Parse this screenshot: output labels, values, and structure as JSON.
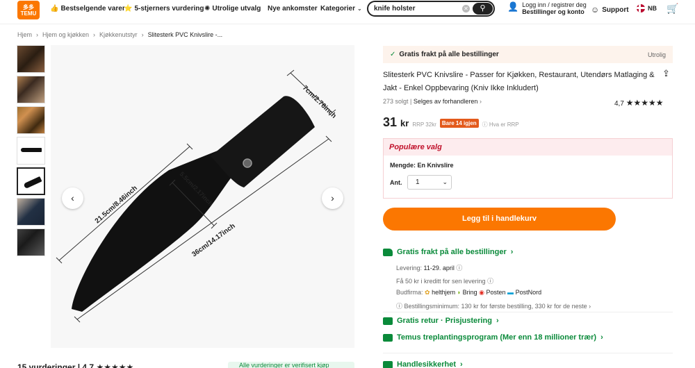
{
  "header": {
    "logo_top": "多多",
    "logo_bottom": "TEMU",
    "nav": [
      {
        "icon": "thumbs-up-icon",
        "label": "Bestselgende varer"
      },
      {
        "icon": "chat-star-icon",
        "label": "5-stjerners vurdering"
      },
      {
        "icon": "sparkle-icon",
        "label": "Utrolige utvalg"
      },
      {
        "icon": "",
        "label": "Nye ankomster"
      },
      {
        "icon": "",
        "label": "Kategorier"
      }
    ],
    "search_value": "knife holster",
    "login_line1": "Logg inn / registrer deg",
    "login_line2": "Bestillinger og konto",
    "support": "Support",
    "lang": "NB"
  },
  "breadcrumb": [
    "Hjem",
    "Hjem og kjøkken",
    "Kjøkkenutstyr",
    "Slitesterk PVC Knivslire -..."
  ],
  "image": {
    "dims": [
      "7cm/2.76inch",
      "21.5cm/8.46inch",
      "5.5cm/2.17inch",
      "36cm/14.17inch"
    ]
  },
  "product": {
    "banner_left": "Gratis frakt på alle bestillinger",
    "banner_right": "Utrolig",
    "title": "Slitesterk PVC Knivslire - Passer for Kjøkken, Restaurant, Utendørs Matlaging & Jakt - Enkel Oppbevaring (Kniv Ikke Inkludert)",
    "sold": "273 solgt",
    "seller": "Selges av forhandleren",
    "rating": "4,7",
    "stars": "★★★★★",
    "price": "31",
    "price_unit": "kr",
    "rrp": "RRP 32kr",
    "badge": "Bare 14 igjen",
    "rrp_info": "Hva er RRP",
    "popular_title": "Populære valg",
    "variant": "Mengde: En Knivslire",
    "qty_label": "Ant.",
    "qty_value": "1",
    "add_to_cart": "Legg til i handlekurv"
  },
  "shipping": {
    "title": "Gratis frakt på alle bestillinger",
    "delivery_label": "Levering:",
    "delivery_value": "11-29. april",
    "credit": "Få 50 kr i kreditt for sen levering",
    "carriers_label": "Budfirma:",
    "carriers": [
      "helthjem",
      "Bring",
      "Posten",
      "PostNord"
    ],
    "minimum": "Bestillingsminimum: 130 kr for første bestilling, 330 kr for de neste",
    "returns": "Gratis retur · Prisjustering",
    "tree": "Temus treplantingsprogram (Mer enn 18 millioner trær)",
    "security": "Handlesikkerhet"
  },
  "bottom": {
    "reviews": "15 vurderinger",
    "rating": "4,7",
    "stars": "★★★★★",
    "green_note": "Alle vurderinger er verifisert kjøp"
  }
}
